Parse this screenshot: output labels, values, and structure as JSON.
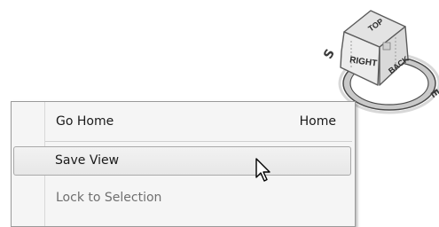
{
  "viewcube": {
    "faces": {
      "top": "TOP",
      "right": "RIGHT",
      "back": "BACK"
    },
    "compass": {
      "south": "S",
      "east": "E"
    }
  },
  "context_menu": {
    "items": [
      {
        "label": "Go Home",
        "shortcut": "Home",
        "state": "normal"
      },
      {
        "label": "Save View",
        "shortcut": "",
        "state": "hovered"
      },
      {
        "label": "Lock to Selection",
        "shortcut": "",
        "state": "disabled"
      }
    ]
  },
  "colors": {
    "menu_background": "#f5f5f5",
    "menu_border": "#9a9a9a",
    "hover_background": "#e9e9e9",
    "disabled_text": "#6f6f6f"
  },
  "icons": {
    "pointer": "mouse-pointer-icon"
  }
}
